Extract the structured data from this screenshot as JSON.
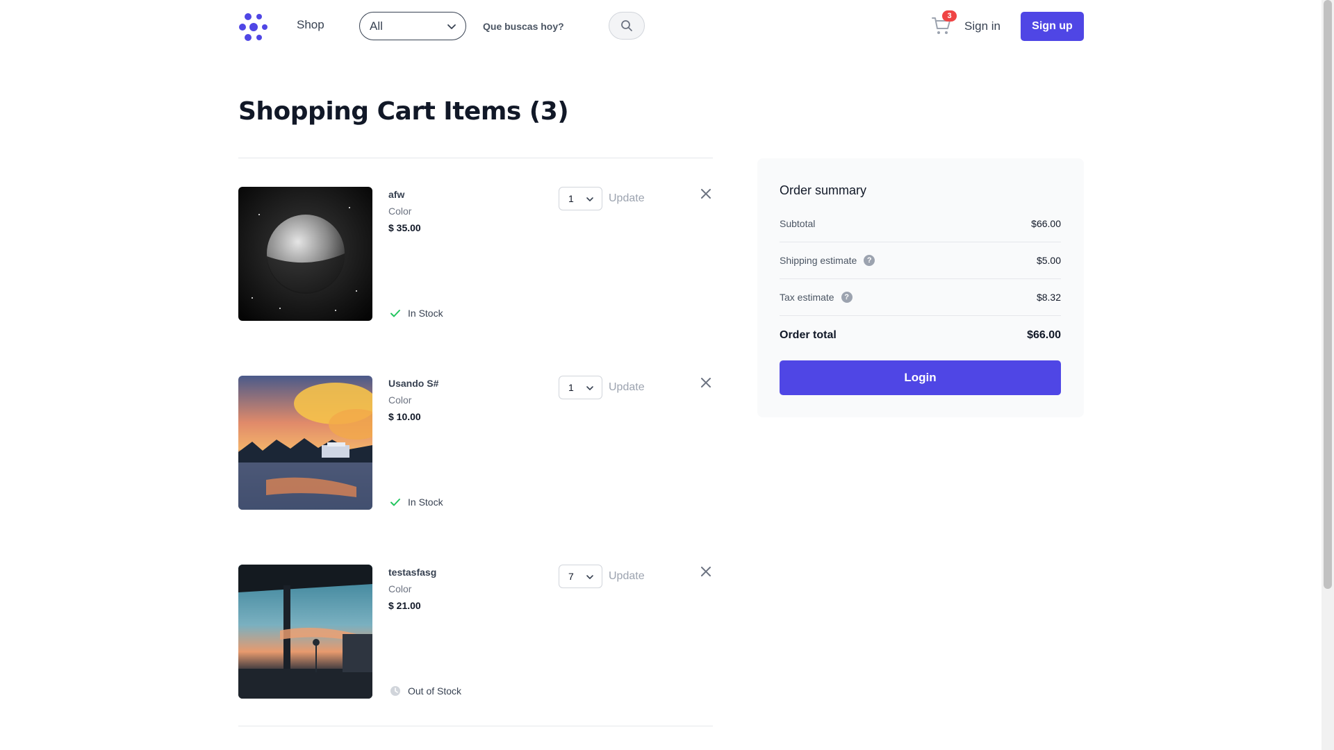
{
  "header": {
    "shop_label": "Shop",
    "category_selected": "All",
    "search_placeholder": "Que buscas hoy?",
    "cart_count": "3",
    "signin_label": "Sign in",
    "signup_label": "Sign up"
  },
  "page": {
    "title": "Shopping Cart Items (3)"
  },
  "cart_items": [
    {
      "name": "afw",
      "color_label": "Color",
      "price": "$ 35.00",
      "quantity": "1",
      "update_label": "Update",
      "stock_status": "In Stock",
      "image_icon": "moon-image"
    },
    {
      "name": "Usando S#",
      "color_label": "Color",
      "price": "$ 10.00",
      "quantity": "1",
      "update_label": "Update",
      "stock_status": "In Stock",
      "image_icon": "sunset-cafe-image"
    },
    {
      "name": "testasfasg",
      "color_label": "Color",
      "price": "$ 21.00",
      "quantity": "7",
      "update_label": "Update",
      "stock_status": "Out of Stock",
      "image_icon": "station-sunset-image"
    }
  ],
  "summary": {
    "title": "Order summary",
    "subtotal_label": "Subtotal",
    "subtotal_value": "$66.00",
    "shipping_label": "Shipping estimate",
    "shipping_value": "$5.00",
    "tax_label": "Tax estimate",
    "tax_value": "$8.32",
    "total_label": "Order total",
    "total_value": "$66.00",
    "login_label": "Login"
  },
  "colors": {
    "accent": "#4f46e5",
    "badge": "#ef4444",
    "in_stock": "#22c55e",
    "out_of_stock": "#9ca3af"
  }
}
